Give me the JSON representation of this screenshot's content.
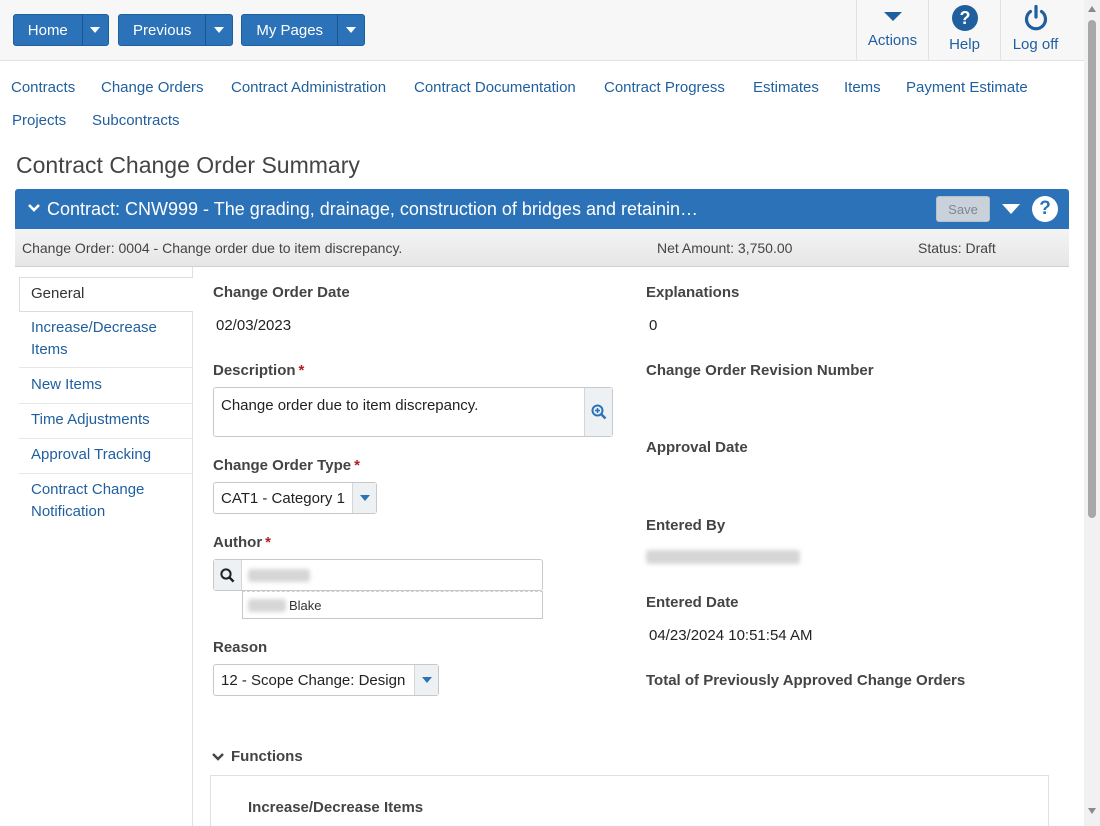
{
  "toolbar": {
    "home_label": "Home",
    "previous_label": "Previous",
    "mypages_label": "My Pages",
    "actions_label": "Actions",
    "help_label": "Help",
    "logoff_label": "Log off"
  },
  "nav": {
    "items": [
      "Contracts",
      "Change Orders",
      "Contract Administration",
      "Contract Documentation",
      "Contract Progress",
      "Estimates",
      "Items",
      "Payment Estimate",
      "Projects",
      "Subcontracts"
    ]
  },
  "page": {
    "title": "Contract Change Order Summary"
  },
  "contract_bar": {
    "title": "Contract: CNW999 - The grading, drainage, construction of bridges and retainin…",
    "save_label": "Save",
    "help_glyph": "?"
  },
  "summary": {
    "change_order": "Change Order: 0004 - Change order due to item discrepancy.",
    "net_amount": "Net Amount: 3,750.00",
    "status": "Status: Draft"
  },
  "tabs": [
    "General",
    "Increase/Decrease Items",
    "New Items",
    "Time Adjustments",
    "Approval Tracking",
    "Contract Change Notification"
  ],
  "form": {
    "change_order_date_label": "Change Order Date",
    "change_order_date": "02/03/2023",
    "description_label": "Description",
    "description_value": "Change order due to item discrepancy.",
    "change_order_type_label": "Change Order Type",
    "change_order_type_value": "CAT1 - Category 1",
    "author_label": "Author",
    "author_suggestion": "Blake",
    "reason_label": "Reason",
    "reason_value": "12 - Scope Change: Design",
    "explanations_label": "Explanations",
    "explanations_value": "0",
    "revision_label": "Change Order Revision Number",
    "approval_date_label": "Approval Date",
    "entered_by_label": "Entered By",
    "entered_date_label": "Entered Date",
    "entered_date_value": "04/23/2024 10:51:54 AM",
    "total_prev_label": "Total of Previously Approved Change Orders",
    "required_mark": "*"
  },
  "functions": {
    "heading": "Functions",
    "first_item": "Increase/Decrease Items"
  },
  "colors": {
    "accent": "#2b72b8",
    "link": "#1f5f9e",
    "required": "#b01c1c"
  }
}
